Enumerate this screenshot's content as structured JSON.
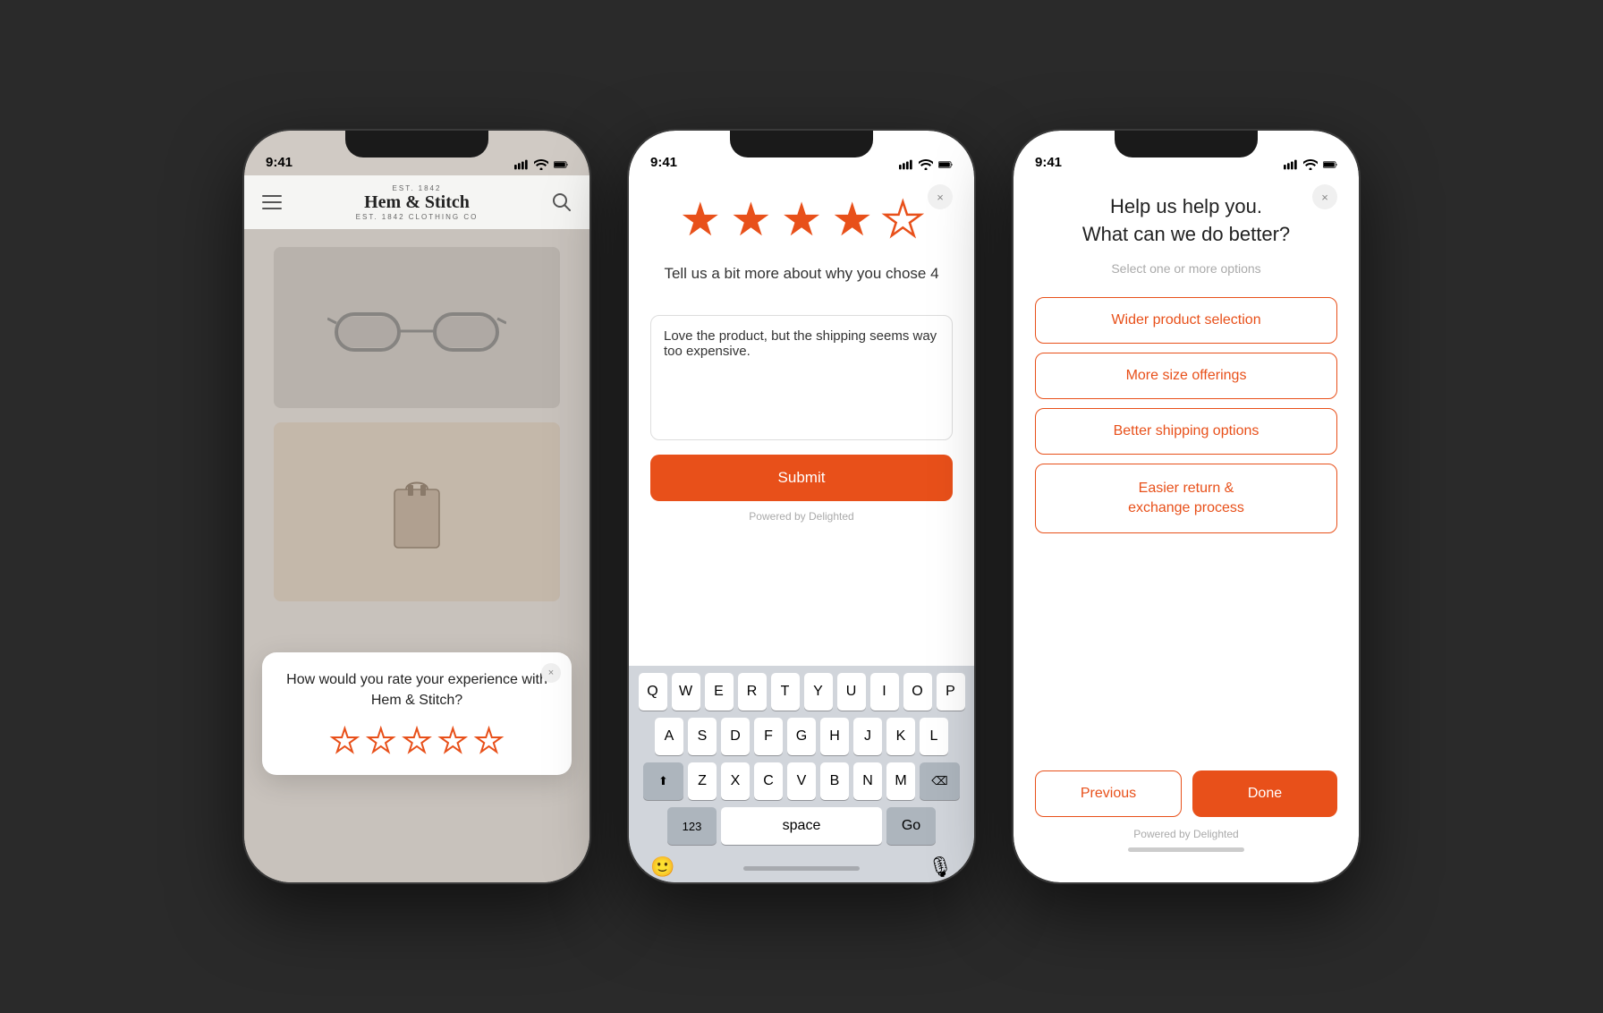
{
  "phone1": {
    "time": "9:41",
    "brand": "Hem & Stitch",
    "brand_sub": "EST. 1842 CLOTHING CO",
    "survey": {
      "close": "×",
      "question": "How would you rate your experience with Hem & Stitch?",
      "stars": [
        false,
        false,
        false,
        false,
        false
      ]
    }
  },
  "phone2": {
    "time": "9:41",
    "close": "×",
    "rating_stars": [
      true,
      true,
      true,
      true,
      false
    ],
    "rating_label": "Tell us a bit more about why you chose 4",
    "feedback_text": "Love the product, but the shipping seems way too expensive.",
    "submit_label": "Submit",
    "powered_by": "Powered by Delighted",
    "keyboard": {
      "row1": [
        "Q",
        "W",
        "E",
        "R",
        "T",
        "Y",
        "U",
        "I",
        "O",
        "P"
      ],
      "row2": [
        "A",
        "S",
        "D",
        "F",
        "G",
        "H",
        "J",
        "K",
        "L"
      ],
      "row3": [
        "Z",
        "X",
        "C",
        "V",
        "B",
        "N",
        "M"
      ],
      "num_label": "123",
      "space_label": "space",
      "go_label": "Go"
    }
  },
  "phone3": {
    "time": "9:41",
    "close": "×",
    "title_line1": "Help us help you.",
    "title_line2": "What can we do better?",
    "subtitle": "Select one or more options",
    "options": [
      "Wider product selection",
      "More size offerings",
      "Better shipping options",
      "Easier return &\nexchange process"
    ],
    "option_labels": [
      "Wider product selection",
      "More size offerings",
      "Better shipping options",
      "Easier return & exchange process"
    ],
    "previous_label": "Previous",
    "done_label": "Done",
    "powered_by": "Powered by Delighted"
  }
}
